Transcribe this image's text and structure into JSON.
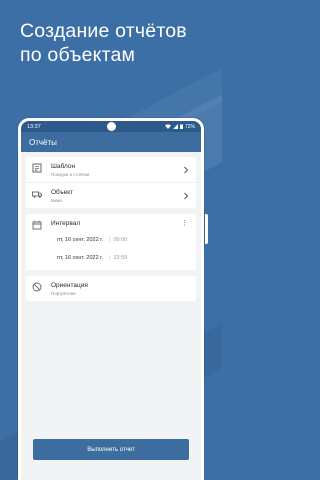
{
  "headline": "Создание отчётов по объектам",
  "status_bar": {
    "time": "13:37",
    "battery": "72%"
  },
  "app_bar": {
    "title": "Отчёты"
  },
  "template_row": {
    "title": "Шаблон",
    "subtitle": "Поездки и стоянки"
  },
  "object_row": {
    "title": "Объект",
    "subtitle": "Вижн"
  },
  "interval": {
    "title": "Интервал",
    "start_date": "пт, 16 сент. 2022 г.",
    "start_time": "00:00",
    "end_date": "пт, 16 сент. 2022 г.",
    "end_time": "23:59",
    "separator": "|"
  },
  "orientation_row": {
    "title": "Ориентация",
    "subtitle": "Портретная"
  },
  "run_button": {
    "label": "Выполнить отчет"
  },
  "colors": {
    "background": "#3c6fa6",
    "app_bar": "#3d6d9f",
    "status_bar": "#2c5a8a"
  }
}
